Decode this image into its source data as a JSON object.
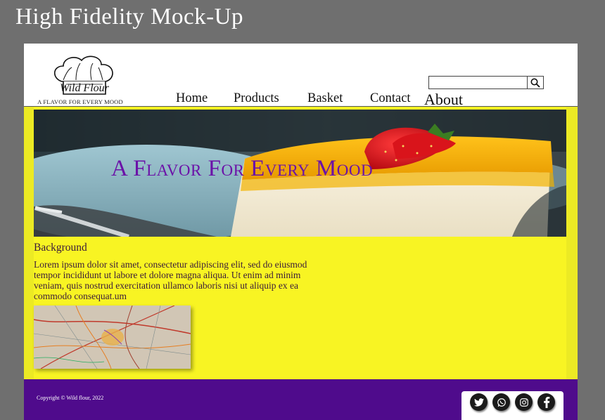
{
  "page": {
    "title": "High Fidelity Mock-Up"
  },
  "header": {
    "logo_text": "Wild Flour",
    "tagline": "A FLAVOR FOR EVERY MOOD",
    "search": {
      "value": "",
      "placeholder": "",
      "icon": "search-icon"
    },
    "nav": [
      {
        "label": "Home"
      },
      {
        "label": "Products"
      },
      {
        "label": "Basket"
      },
      {
        "label": "Contact"
      },
      {
        "label": "About"
      }
    ]
  },
  "hero": {
    "headline": "A Flavor For Every Mood"
  },
  "main": {
    "heading": "Background",
    "body": "Lorem ipsum dolor sit amet, consectetur adipiscing elit, sed do eiusmod tempor incididunt ut labore et dolore magna aliqua. Ut enim ad minim veniam, quis nostrud exercitation ullamco laboris nisi ut aliquip ex ea commodo consequat.um"
  },
  "footer": {
    "copyright": "Copyright © Wild flour, 2022",
    "social": [
      "twitter-icon",
      "whatsapp-icon",
      "instagram-icon",
      "facebook-icon"
    ]
  },
  "colors": {
    "background": "#6f6f6f",
    "content_yellow": "#f8f423",
    "footer_purple": "#4f0b8c",
    "hero_text": "#6b12a8"
  }
}
